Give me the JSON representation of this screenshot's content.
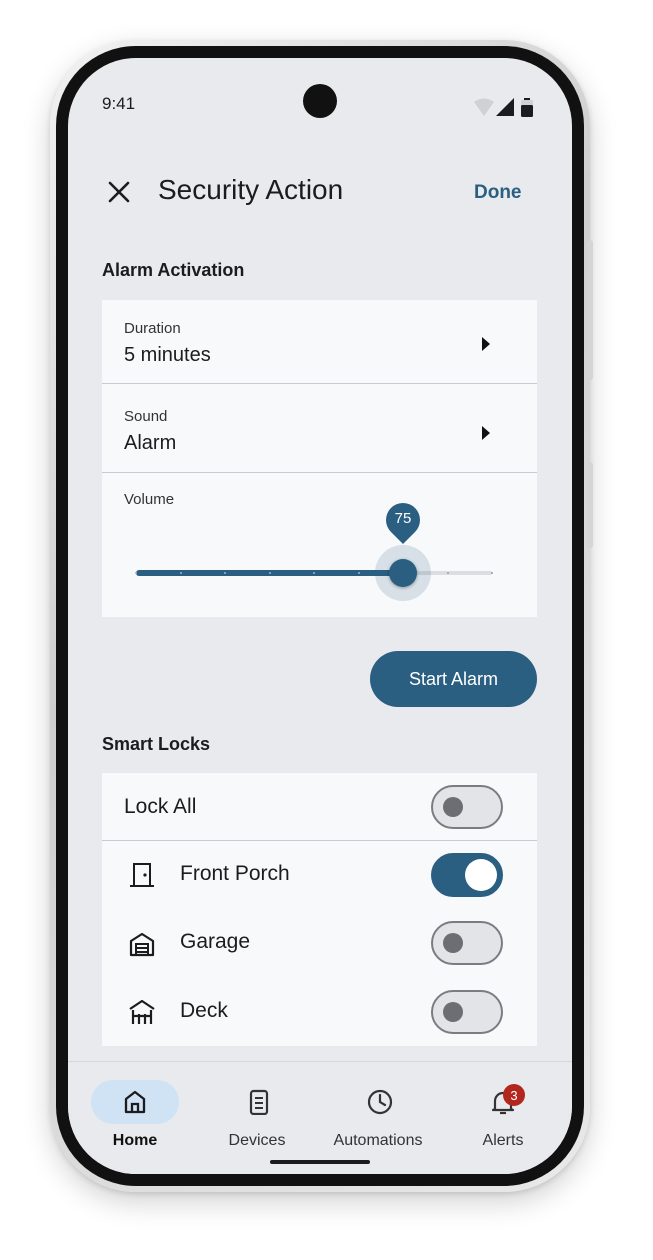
{
  "status_bar": {
    "time": "9:41"
  },
  "app_bar": {
    "title": "Security Action",
    "done_label": "Done"
  },
  "alarm": {
    "section_title": "Alarm Activation",
    "duration": {
      "label": "Duration",
      "value": "5 minutes"
    },
    "sound": {
      "label": "Sound",
      "value": "Alarm"
    },
    "volume": {
      "label": "Volume",
      "value": 75,
      "value_text": "75",
      "min": 0,
      "max": 100,
      "steps": 8
    },
    "start_label": "Start Alarm"
  },
  "locks": {
    "section_title": "Smart Locks",
    "lock_all": {
      "label": "Lock All",
      "on": false
    },
    "items": [
      {
        "label": "Front Porch",
        "icon": "door-icon",
        "on": true
      },
      {
        "label": "Garage",
        "icon": "garage-icon",
        "on": false
      },
      {
        "label": "Deck",
        "icon": "deck-icon",
        "on": false
      }
    ]
  },
  "nav": {
    "items": [
      {
        "label": "Home",
        "icon": "home-icon",
        "active": true
      },
      {
        "label": "Devices",
        "icon": "devices-icon",
        "active": false
      },
      {
        "label": "Automations",
        "icon": "clock-icon",
        "active": false
      },
      {
        "label": "Alerts",
        "icon": "bell-icon",
        "active": false,
        "badge": "3"
      }
    ]
  },
  "colors": {
    "accent": "#2a5f82",
    "screen_bg": "#e9eaed",
    "card_bg": "#f8f9fb",
    "badge": "#b3261e",
    "nav_active_pill": "#cfe3f5"
  }
}
